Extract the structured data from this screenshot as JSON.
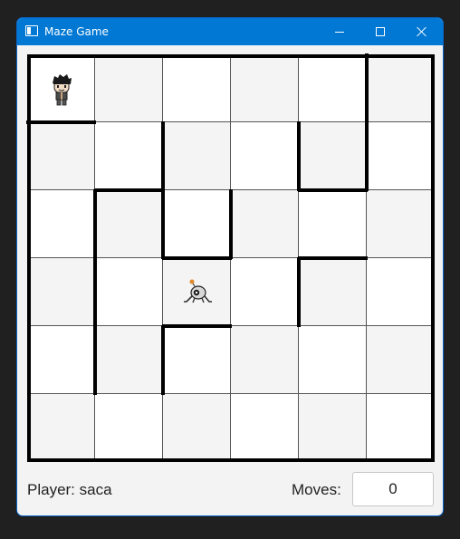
{
  "window": {
    "title": "Maze Game",
    "icon": "window-app-icon",
    "controls": [
      "minimize-icon",
      "maximize-icon",
      "close-icon"
    ]
  },
  "maze": {
    "rows": 6,
    "cols": 6,
    "shaded_cells": [
      [
        0,
        1
      ],
      [
        0,
        3
      ],
      [
        0,
        5
      ],
      [
        1,
        0
      ],
      [
        1,
        2
      ],
      [
        1,
        4
      ],
      [
        2,
        1
      ],
      [
        2,
        3
      ],
      [
        2,
        5
      ],
      [
        3,
        0
      ],
      [
        3,
        2
      ],
      [
        3,
        4
      ],
      [
        4,
        1
      ],
      [
        4,
        3
      ],
      [
        4,
        5
      ],
      [
        5,
        0
      ],
      [
        5,
        2
      ],
      [
        5,
        4
      ]
    ],
    "walls": [
      {
        "row": 1,
        "col": 0,
        "side": "top"
      },
      {
        "row": 0,
        "col": 5,
        "side": "left"
      },
      {
        "row": 1,
        "col": 5,
        "side": "left"
      },
      {
        "row": 1,
        "col": 2,
        "side": "left"
      },
      {
        "row": 2,
        "col": 2,
        "side": "left"
      },
      {
        "row": 1,
        "col": 5,
        "side": "left"
      },
      {
        "row": 1,
        "col": 4,
        "side": "left"
      },
      {
        "row": 2,
        "col": 1,
        "side": "top"
      },
      {
        "row": 2,
        "col": 4,
        "side": "top"
      },
      {
        "row": 2,
        "col": 1,
        "side": "left"
      },
      {
        "row": 3,
        "col": 1,
        "side": "left"
      },
      {
        "row": 4,
        "col": 1,
        "side": "left"
      },
      {
        "row": 2,
        "col": 3,
        "side": "left"
      },
      {
        "row": 3,
        "col": 2,
        "side": "top"
      },
      {
        "row": 3,
        "col": 4,
        "side": "top"
      },
      {
        "row": 3,
        "col": 4,
        "side": "left"
      },
      {
        "row": 4,
        "col": 2,
        "side": "top"
      },
      {
        "row": 4,
        "col": 2,
        "side": "left"
      }
    ],
    "player": {
      "row": 0,
      "col": 0,
      "icon": "player-character-icon"
    },
    "goal": {
      "row": 3,
      "col": 2,
      "icon": "robot-goal-icon"
    }
  },
  "status": {
    "player_text": "Player: saca",
    "moves_label": "Moves:",
    "moves_value": "0"
  },
  "colors": {
    "titlebar": "#0078d4",
    "shade": "#f4f4f4",
    "wall": "#000000"
  }
}
